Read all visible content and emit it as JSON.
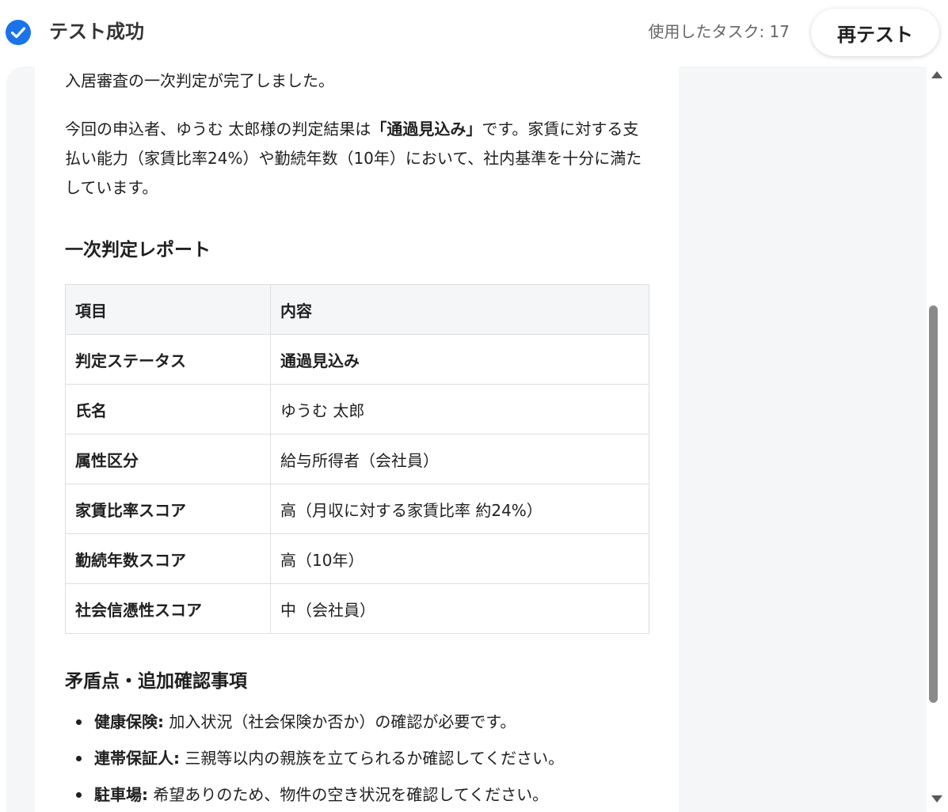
{
  "header": {
    "title": "テスト成功",
    "task_count": "使用したタスク: 17",
    "retest_label": "再テスト",
    "accent_color": "#1a73e8"
  },
  "content": {
    "intro": "入居審査の一次判定が完了しました。",
    "summary": {
      "part1": "今回の申込者、ゆうむ 太郎様の判定結果は",
      "highlight": "「通過見込み」",
      "part2": "です。家賃に対する支払い能力（家賃比率24%）や勤続年数（10年）において、社内基準を十分に満たしています。"
    },
    "report_title": "一次判定レポート",
    "table": {
      "headers": [
        "項目",
        "内容"
      ],
      "rows": [
        {
          "key": "判定ステータス",
          "value": "通過見込み"
        },
        {
          "key": "氏名",
          "value": "ゆうむ 太郎"
        },
        {
          "key": "属性区分",
          "value": "給与所得者（会社員）"
        },
        {
          "key": "家賃比率スコア",
          "value": "高（月収に対する家賃比率 約24%）"
        },
        {
          "key": "勤続年数スコア",
          "value": "高（10年）"
        },
        {
          "key": "社会信憑性スコア",
          "value": "中（会社員）"
        }
      ]
    },
    "issues_title": "矛盾点・追加確認事項",
    "issues": [
      {
        "label": "健康保険:",
        "text": " 加入状況（社会保険か否か）の確認が必要です。"
      },
      {
        "label": "連帯保証人:",
        "text": " 三親等以内の親族を立てられるか確認してください。"
      },
      {
        "label": "駐車場:",
        "text": " 希望ありのため、物件の空き状況を確認してください。"
      }
    ]
  }
}
